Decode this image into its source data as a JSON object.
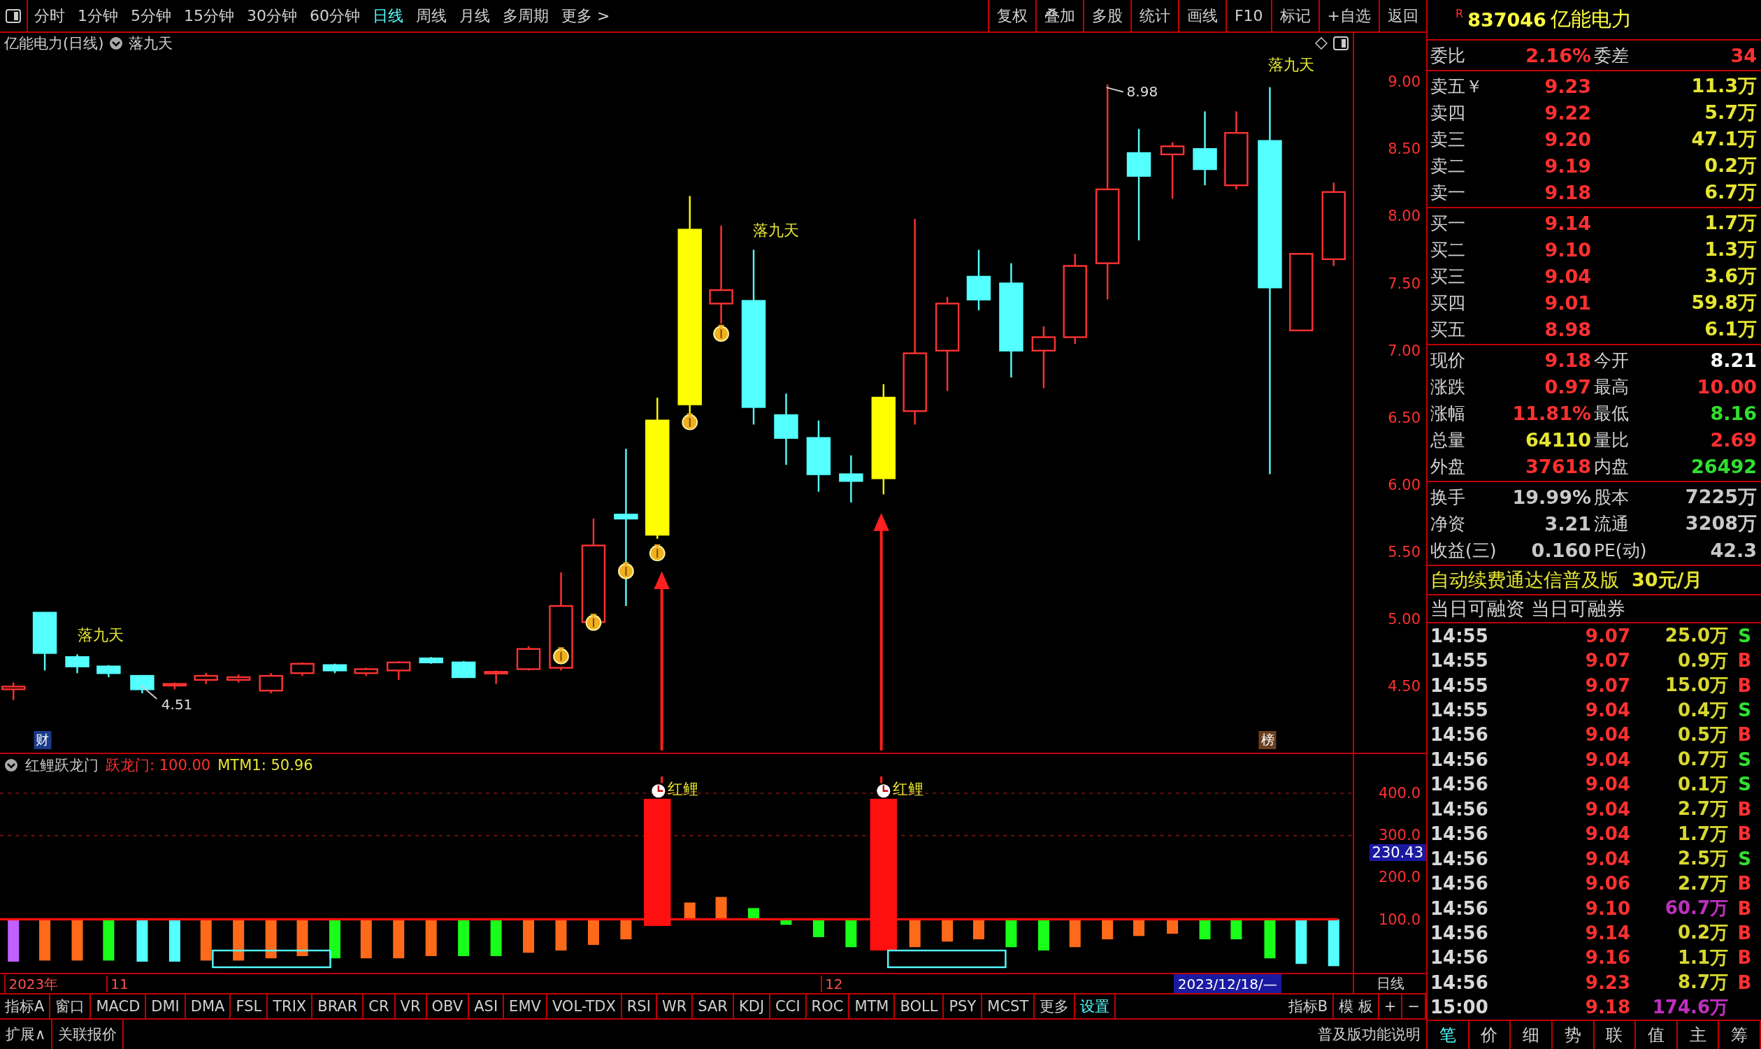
{
  "toolbar": {
    "periods": [
      {
        "label": "分时",
        "selected": false
      },
      {
        "label": "1分钟",
        "selected": false
      },
      {
        "label": "5分钟",
        "selected": false
      },
      {
        "label": "15分钟",
        "selected": false
      },
      {
        "label": "30分钟",
        "selected": false
      },
      {
        "label": "60分钟",
        "selected": false
      },
      {
        "label": "日线",
        "selected": true
      },
      {
        "label": "周线",
        "selected": false
      },
      {
        "label": "月线",
        "selected": false
      },
      {
        "label": "多周期",
        "selected": false
      },
      {
        "label": "更多 >",
        "selected": false
      }
    ],
    "actions": [
      "复权",
      "叠加",
      "多股",
      "统计",
      "画线",
      "F10",
      "标记",
      "+自选",
      "返回"
    ]
  },
  "chart": {
    "title": "亿能电力(日线)",
    "indicator_name": "落九天",
    "price_axis": [
      "9.00",
      "8.50",
      "8.00",
      "7.50",
      "7.00",
      "6.50",
      "6.00",
      "5.50",
      "5.00",
      "4.50"
    ],
    "annotations": [
      "落九天",
      "落九天",
      "落九天"
    ],
    "high_label": "8.98",
    "low_label": "4.51",
    "badges": [
      "财",
      "榜"
    ]
  },
  "sub_chart": {
    "name": "红鲤跃龙门",
    "values": [
      {
        "label": "跃龙门: 100.00",
        "color": "#ff3030"
      },
      {
        "label": "MTM1: 50.96",
        "color": "#e6e632"
      }
    ],
    "axis": [
      "400.0",
      "300.0",
      "200.0",
      "100.0"
    ],
    "current_value": "230.43",
    "signals": [
      "红鲤",
      "红鲤"
    ]
  },
  "date_axis": {
    "labels": [
      "2023年",
      "11",
      "12"
    ],
    "cursor_date": "2023/12/18/—",
    "period": "日线"
  },
  "indicator_tabs": [
    {
      "label": "指标A",
      "selected": false
    },
    {
      "label": "窗口",
      "selected": false
    },
    {
      "label": "MACD",
      "selected": false
    },
    {
      "label": "DMI",
      "selected": false
    },
    {
      "label": "DMA",
      "selected": false
    },
    {
      "label": "FSL",
      "selected": false
    },
    {
      "label": "TRIX",
      "selected": false
    },
    {
      "label": "BRAR",
      "selected": false
    },
    {
      "label": "CR",
      "selected": false
    },
    {
      "label": "VR",
      "selected": false
    },
    {
      "label": "OBV",
      "selected": false
    },
    {
      "label": "ASI",
      "selected": false
    },
    {
      "label": "EMV",
      "selected": false
    },
    {
      "label": "VOL-TDX",
      "selected": false
    },
    {
      "label": "RSI",
      "selected": false
    },
    {
      "label": "WR",
      "selected": false
    },
    {
      "label": "SAR",
      "selected": false
    },
    {
      "label": "KDJ",
      "selected": false
    },
    {
      "label": "CCI",
      "selected": false
    },
    {
      "label": "ROC",
      "selected": false
    },
    {
      "label": "MTM",
      "selected": false
    },
    {
      "label": "BOLL",
      "selected": false
    },
    {
      "label": "PSY",
      "selected": false
    },
    {
      "label": "MCST",
      "selected": false
    },
    {
      "label": "更多",
      "selected": false
    },
    {
      "label": "设置",
      "selected": true
    }
  ],
  "extra_tabs": [
    "指标B",
    "模 板",
    "+",
    "−"
  ],
  "status_bar": {
    "left": [
      "扩展∧",
      "关联报价"
    ],
    "right": "普及版功能说明"
  },
  "quote": {
    "flag": "R",
    "code": "837046",
    "name": "亿能电力",
    "order_ratio": [
      {
        "label": "委比",
        "value": "2.16%",
        "color": "#ff3030"
      },
      {
        "label": "委差",
        "value": "34",
        "color": "#ff3030"
      }
    ],
    "asks": [
      {
        "label": "卖五￥",
        "price": "9.23",
        "volume": "11.3万"
      },
      {
        "label": "卖四",
        "price": "9.22",
        "volume": "5.7万"
      },
      {
        "label": "卖三",
        "price": "9.20",
        "volume": "47.1万"
      },
      {
        "label": "卖二",
        "price": "9.19",
        "volume": "0.2万"
      },
      {
        "label": "卖一",
        "price": "9.18",
        "volume": "6.7万"
      }
    ],
    "bids": [
      {
        "label": "买一",
        "price": "9.14",
        "volume": "1.7万"
      },
      {
        "label": "买二",
        "price": "9.10",
        "volume": "1.3万"
      },
      {
        "label": "买三",
        "price": "9.04",
        "volume": "3.6万"
      },
      {
        "label": "买四",
        "price": "9.01",
        "volume": "59.8万"
      },
      {
        "label": "买五",
        "price": "8.98",
        "volume": "6.1万"
      }
    ],
    "stats": [
      [
        {
          "label": "现价",
          "value": "9.18",
          "color": "#ff3030"
        },
        {
          "label": "今开",
          "value": "8.21",
          "color": "#ffffff"
        }
      ],
      [
        {
          "label": "涨跌",
          "value": "0.97",
          "color": "#ff3030"
        },
        {
          "label": "最高",
          "value": "10.00",
          "color": "#ff3030"
        }
      ],
      [
        {
          "label": "涨幅",
          "value": "11.81%",
          "color": "#ff3030"
        },
        {
          "label": "最低",
          "value": "8.16",
          "color": "#30e030"
        }
      ],
      [
        {
          "label": "总量",
          "value": "64110",
          "color": "#e6e632"
        },
        {
          "label": "量比",
          "value": "2.69",
          "color": "#ff3030"
        }
      ],
      [
        {
          "label": "外盘",
          "value": "37618",
          "color": "#ff3030"
        },
        {
          "label": "内盘",
          "value": "26492",
          "color": "#30e030"
        }
      ]
    ],
    "fundamentals": [
      [
        {
          "label": "换手",
          "value": "19.99%",
          "color": "#c8c8c8"
        },
        {
          "label": "股本",
          "value": "7225万",
          "color": "#c8c8c8"
        }
      ],
      [
        {
          "label": "净资",
          "value": "3.21",
          "color": "#c8c8c8"
        },
        {
          "label": "流通",
          "value": "3208万",
          "color": "#c8c8c8"
        }
      ],
      [
        {
          "label": "收益(三)",
          "value": "0.160",
          "color": "#c8c8c8"
        },
        {
          "label": "PE(动)",
          "value": "42.3",
          "color": "#c8c8c8"
        }
      ]
    ],
    "promo": {
      "text": "自动续费通达信普及版",
      "price": "30元/月"
    },
    "margin": "当日可融资 当日可融券",
    "trades": [
      {
        "time": "14:55",
        "price": "9.07",
        "volume": "25.0万",
        "large": false,
        "side": {
          "label": "S",
          "color": "#30e030"
        }
      },
      {
        "time": "14:55",
        "price": "9.07",
        "volume": "0.9万",
        "large": false,
        "side": {
          "label": "B",
          "color": "#ff3030"
        }
      },
      {
        "time": "14:55",
        "price": "9.07",
        "volume": "15.0万",
        "large": false,
        "side": {
          "label": "B",
          "color": "#ff3030"
        }
      },
      {
        "time": "14:55",
        "price": "9.04",
        "volume": "0.4万",
        "large": false,
        "side": {
          "label": "S",
          "color": "#30e030"
        }
      },
      {
        "time": "14:56",
        "price": "9.04",
        "volume": "0.5万",
        "large": false,
        "side": {
          "label": "B",
          "color": "#ff3030"
        }
      },
      {
        "time": "14:56",
        "price": "9.04",
        "volume": "0.7万",
        "large": false,
        "side": {
          "label": "S",
          "color": "#30e030"
        }
      },
      {
        "time": "14:56",
        "price": "9.04",
        "volume": "0.1万",
        "large": false,
        "side": {
          "label": "S",
          "color": "#30e030"
        }
      },
      {
        "time": "14:56",
        "price": "9.04",
        "volume": "2.7万",
        "large": false,
        "side": {
          "label": "B",
          "color": "#ff3030"
        }
      },
      {
        "time": "14:56",
        "price": "9.04",
        "volume": "1.7万",
        "large": false,
        "side": {
          "label": "B",
          "color": "#ff3030"
        }
      },
      {
        "time": "14:56",
        "price": "9.04",
        "volume": "2.5万",
        "large": false,
        "side": {
          "label": "S",
          "color": "#30e030"
        }
      },
      {
        "time": "14:56",
        "price": "9.06",
        "volume": "2.7万",
        "large": false,
        "side": {
          "label": "B",
          "color": "#ff3030"
        }
      },
      {
        "time": "14:56",
        "price": "9.10",
        "volume": "60.7万",
        "large": true,
        "side": {
          "label": "B",
          "color": "#ff3030"
        }
      },
      {
        "time": "14:56",
        "price": "9.14",
        "volume": "0.2万",
        "large": false,
        "side": {
          "label": "B",
          "color": "#ff3030"
        }
      },
      {
        "time": "14:56",
        "price": "9.16",
        "volume": "1.1万",
        "large": false,
        "side": {
          "label": "B",
          "color": "#ff3030"
        }
      },
      {
        "time": "14:56",
        "price": "9.23",
        "volume": "8.7万",
        "large": false,
        "side": {
          "label": "B",
          "color": "#ff3030"
        }
      },
      {
        "time": "15:00",
        "price": "9.18",
        "volume": "174.6万",
        "large": true
      }
    ],
    "detail_tabs": [
      {
        "label": "笔",
        "selected": true
      },
      {
        "label": "价",
        "selected": false
      },
      {
        "label": "细",
        "selected": false
      },
      {
        "label": "势",
        "selected": false
      },
      {
        "label": "联",
        "selected": false
      },
      {
        "label": "值",
        "selected": false
      },
      {
        "label": "主",
        "selected": false
      },
      {
        "label": "筹",
        "selected": false
      }
    ]
  }
}
